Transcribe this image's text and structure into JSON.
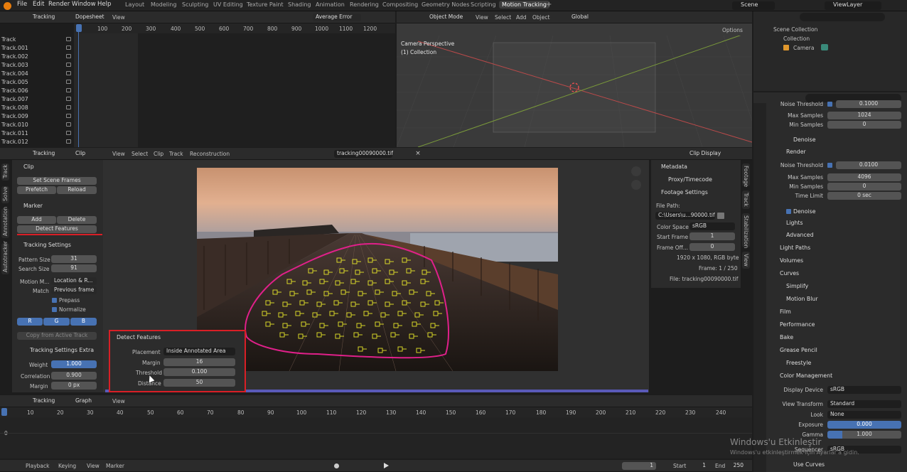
{
  "menus": [
    "File",
    "Edit",
    "Render",
    "Window",
    "Help"
  ],
  "workspaces": [
    "Layout",
    "Modeling",
    "Sculpting",
    "UV Editing",
    "Texture Paint",
    "Shading",
    "Animation",
    "Rendering",
    "Compositing",
    "Geometry Nodes",
    "Scripting",
    "Motion Tracking"
  ],
  "active_workspace": "Motion Tracking",
  "scene": "Scene",
  "view_layer": "ViewLayer",
  "dopesheet": {
    "mode": "Tracking",
    "type": "Dopesheet",
    "view": "View",
    "sort": "Average Error",
    "frames": [
      "1",
      "100",
      "200",
      "300",
      "400",
      "500",
      "600",
      "700",
      "800",
      "900",
      "1000",
      "1100",
      "1200"
    ],
    "tracks": [
      "Track",
      "Track.001",
      "Track.002",
      "Track.003",
      "Track.004",
      "Track.005",
      "Track.006",
      "Track.007",
      "Track.008",
      "Track.009",
      "Track.010",
      "Track.011",
      "Track.012"
    ]
  },
  "viewport": {
    "mode": "Object Mode",
    "menus": [
      "View",
      "Select",
      "Add",
      "Object"
    ],
    "orient": "Global",
    "options": "Options",
    "cam_title": "Camera Perspective",
    "cam_sub": "(1) Collection"
  },
  "outliner": {
    "root": "Scene Collection",
    "collection": "Collection",
    "camera": "Camera"
  },
  "clip_header": {
    "mode": "Tracking",
    "type": "Clip",
    "menus": [
      "View",
      "Select",
      "Clip",
      "Track",
      "Reconstruction"
    ],
    "file": "tracking00090000.tif",
    "display": "Clip Display"
  },
  "left_tabs": [
    "Track",
    "Solve",
    "Annotation",
    "Autotracker"
  ],
  "clip_panel": {
    "title": "Clip",
    "set_scene": "Set Scene Frames",
    "prefetch": "Prefetch",
    "reload": "Reload"
  },
  "marker_panel": {
    "title": "Marker",
    "add": "Add",
    "delete": "Delete",
    "detect": "Detect Features"
  },
  "tracking_settings": {
    "title": "Tracking Settings",
    "pattern_label": "Pattern Size",
    "pattern": "31",
    "search_label": "Search Size",
    "search": "91",
    "motion_label": "Motion M...",
    "motion": "Location & R...",
    "match_label": "Match",
    "match": "Previous frame",
    "prepass": "Prepass",
    "normalize": "Normalize",
    "r": "R",
    "g": "G",
    "b": "B",
    "copy": "Copy from Active Track"
  },
  "tracking_extra": {
    "title": "Tracking Settings Extra",
    "weight_label": "Weight",
    "weight": "1.000",
    "corr_label": "Correlation",
    "corr": "0.900",
    "margin_label": "Margin",
    "margin": "0 px"
  },
  "detect_popup": {
    "title": "Detect Features",
    "placement_label": "Placement",
    "placement": "Inside Annotated Area",
    "margin_label": "Margin",
    "margin": "16",
    "threshold_label": "Threshold",
    "threshold": "0.100",
    "distance_label": "Distance",
    "distance": "50"
  },
  "right_tabs": [
    "Footage",
    "Track",
    "Stabilization",
    "View"
  ],
  "footage": {
    "metadata": "Metadata",
    "proxy": "Proxy/Timecode",
    "settings": "Footage Settings",
    "file_path_label": "File Path:",
    "file_path": "C:\\Users\\u...90000.tif",
    "color_label": "Color Space",
    "color": "sRGB",
    "start_label": "Start Frame",
    "start": "1",
    "offset_label": "Frame Off...",
    "offset": "0",
    "res": "1920 x 1080, RGB byte",
    "frame": "Frame: 1 / 250",
    "file": "File: tracking00090000.tif"
  },
  "graph": {
    "mode": "Tracking",
    "type": "Graph",
    "view": "View",
    "frames": [
      "1",
      "10",
      "20",
      "30",
      "40",
      "50",
      "60",
      "70",
      "80",
      "90",
      "100",
      "110",
      "120",
      "130",
      "140",
      "150",
      "160",
      "170",
      "180",
      "190",
      "200",
      "210",
      "220",
      "230",
      "240"
    ],
    "zero": "0"
  },
  "playback": {
    "playback": "Playback",
    "keying": "Keying",
    "view": "View",
    "marker": "Marker",
    "current": "1",
    "start_label": "Start",
    "start": "1",
    "end_label": "End",
    "end": "250"
  },
  "props": {
    "noise_thr_top": "Noise Threshold",
    "noise_top": "0.1000",
    "max_samples_label": "Max Samples",
    "max_samples": "1024",
    "min_samples_label": "Min Samples",
    "min_samples": "0",
    "denoise": "Denoise",
    "render": "Render",
    "r_noise_label": "Noise Threshold",
    "r_noise": "0.0100",
    "r_max_label": "Max Samples",
    "r_max": "4096",
    "r_min_label": "Min Samples",
    "r_min": "0",
    "time_label": "Time Limit",
    "time": "0 sec",
    "denoise2": "Denoise",
    "lights": "Lights",
    "advanced": "Advanced",
    "light_paths": "Light Paths",
    "volumes": "Volumes",
    "curves": "Curves",
    "simplify": "Simplify",
    "motion_blur": "Motion Blur",
    "film": "Film",
    "performance": "Performance",
    "bake": "Bake",
    "grease": "Grease Pencil",
    "freestyle": "Freestyle",
    "color_mgmt": "Color Management",
    "display_label": "Display Device",
    "display": "sRGB",
    "view_tf_label": "View Transform",
    "view_tf": "Standard",
    "look_label": "Look",
    "look": "None",
    "exposure_label": "Exposure",
    "exposure": "0.000",
    "gamma_label": "Gamma",
    "gamma": "1.000",
    "seq_label": "Sequencer",
    "seq": "sRGB",
    "use_curves": "Use Curves"
  },
  "watermark": {
    "title": "Windows'u Etkinleştir",
    "sub": "Windows'u etkinleştirmek için Ayarlar'a gidin."
  }
}
